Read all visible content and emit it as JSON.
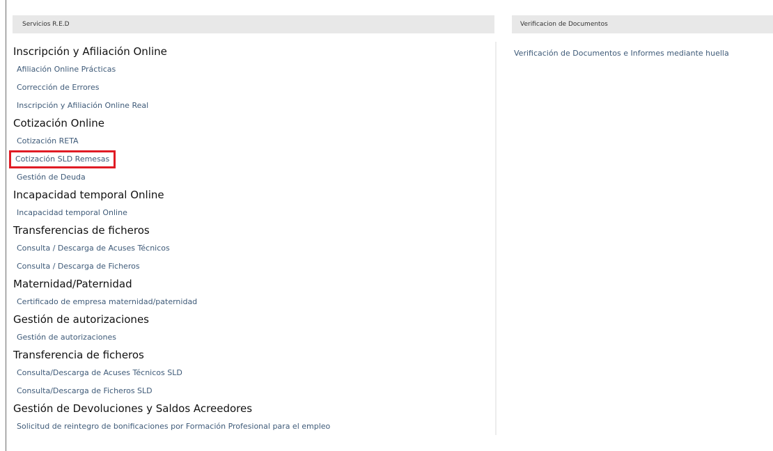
{
  "left_panel": {
    "header": "Servicios R.E.D",
    "sections": [
      {
        "title": "Inscripción y Afiliación Online",
        "links": [
          "Afiliación Online Prácticas",
          "Corrección de Errores",
          "Inscripción y Afiliación Online Real"
        ]
      },
      {
        "title": "Cotización Online",
        "links": [
          "Cotización RETA",
          "Cotización SLD Remesas",
          "Gestión de Deuda"
        ]
      },
      {
        "title": "Incapacidad temporal Online",
        "links": [
          "Incapacidad temporal Online"
        ]
      },
      {
        "title": "Transferencias de ficheros",
        "links": [
          "Consulta / Descarga de Acuses Técnicos",
          "Consulta / Descarga de Ficheros"
        ]
      },
      {
        "title": "Maternidad/Paternidad",
        "links": [
          "Certificado de empresa maternidad/paternidad"
        ]
      },
      {
        "title": "Gestión de autorizaciones",
        "links": [
          "Gestión de autorizaciones"
        ]
      },
      {
        "title": "Transferencia de ficheros",
        "links": [
          "Consulta/Descarga de Acuses Técnicos SLD",
          "Consulta/Descarga de Ficheros SLD"
        ]
      },
      {
        "title": "Gestión de Devoluciones y Saldos Acreedores",
        "links": [
          "Solicitud de reintegro de bonificaciones por Formación Profesional para el empleo"
        ]
      }
    ]
  },
  "right_panel": {
    "header": "Verificacion de Documentos",
    "links": [
      "Verificación de Documentos e Informes mediante huella"
    ]
  },
  "colors": {
    "link": "#3e5a78",
    "heading": "#111111",
    "header_bg": "#e8e8e8",
    "highlight_border": "#e01b24"
  }
}
